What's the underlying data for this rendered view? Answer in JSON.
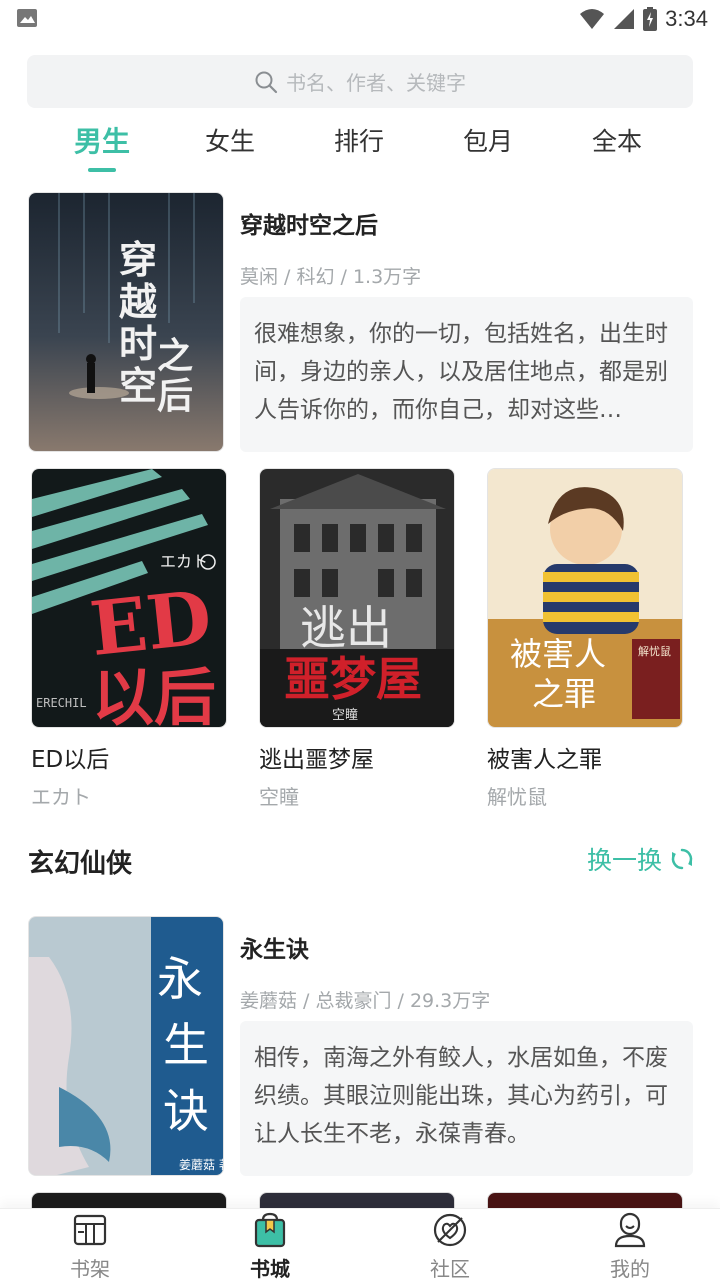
{
  "status_bar": {
    "time": "3:34"
  },
  "search": {
    "placeholder": "书名、作者、关键字"
  },
  "tabs": [
    {
      "label": "男生",
      "active": true
    },
    {
      "label": "女生"
    },
    {
      "label": "排行"
    },
    {
      "label": "包月"
    },
    {
      "label": "全本"
    }
  ],
  "featured": {
    "title": "穿越时空之后",
    "meta": "莫闲 / 科幻 / 1.3万字",
    "desc": "很难想象，你的一切，包括姓名，出生时间，身边的亲人，以及居住地点，都是别人告诉你的，而你自己，却对这些…",
    "cover_text": "穿越时空之后"
  },
  "grid1": [
    {
      "title": "ED以后",
      "author": "エカト",
      "cover_text": "ED以后",
      "cover_tag": "エカト"
    },
    {
      "title": "逃出噩梦屋",
      "author": "空瞳",
      "cover_text": "逃出噩梦屋",
      "cover_tag": "空瞳"
    },
    {
      "title": "被害人之罪",
      "author": "解忧鼠",
      "cover_text": "被害人之罪",
      "cover_tag": "解忧鼠"
    }
  ],
  "section": {
    "title": "玄幻仙侠",
    "refresh_label": "换一换"
  },
  "featured2": {
    "title": "永生诀",
    "meta": "姜蘑菇 / 总裁豪门 / 29.3万字",
    "desc": "相传，南海之外有鲛人，水居如鱼，不废织绩。其眼泣则能出珠，其心为药引，可让人长生不老，永葆青春。",
    "cover_text": "永生诀",
    "cover_author": "姜蘑菇 著"
  },
  "bottom_nav": [
    {
      "label": "书架",
      "icon": "bookshelf-icon"
    },
    {
      "label": "书城",
      "icon": "bookstore-icon",
      "active": true
    },
    {
      "label": "社区",
      "icon": "community-icon"
    },
    {
      "label": "我的",
      "icon": "profile-icon"
    }
  ],
  "colors": {
    "accent": "#3dbfa6"
  }
}
